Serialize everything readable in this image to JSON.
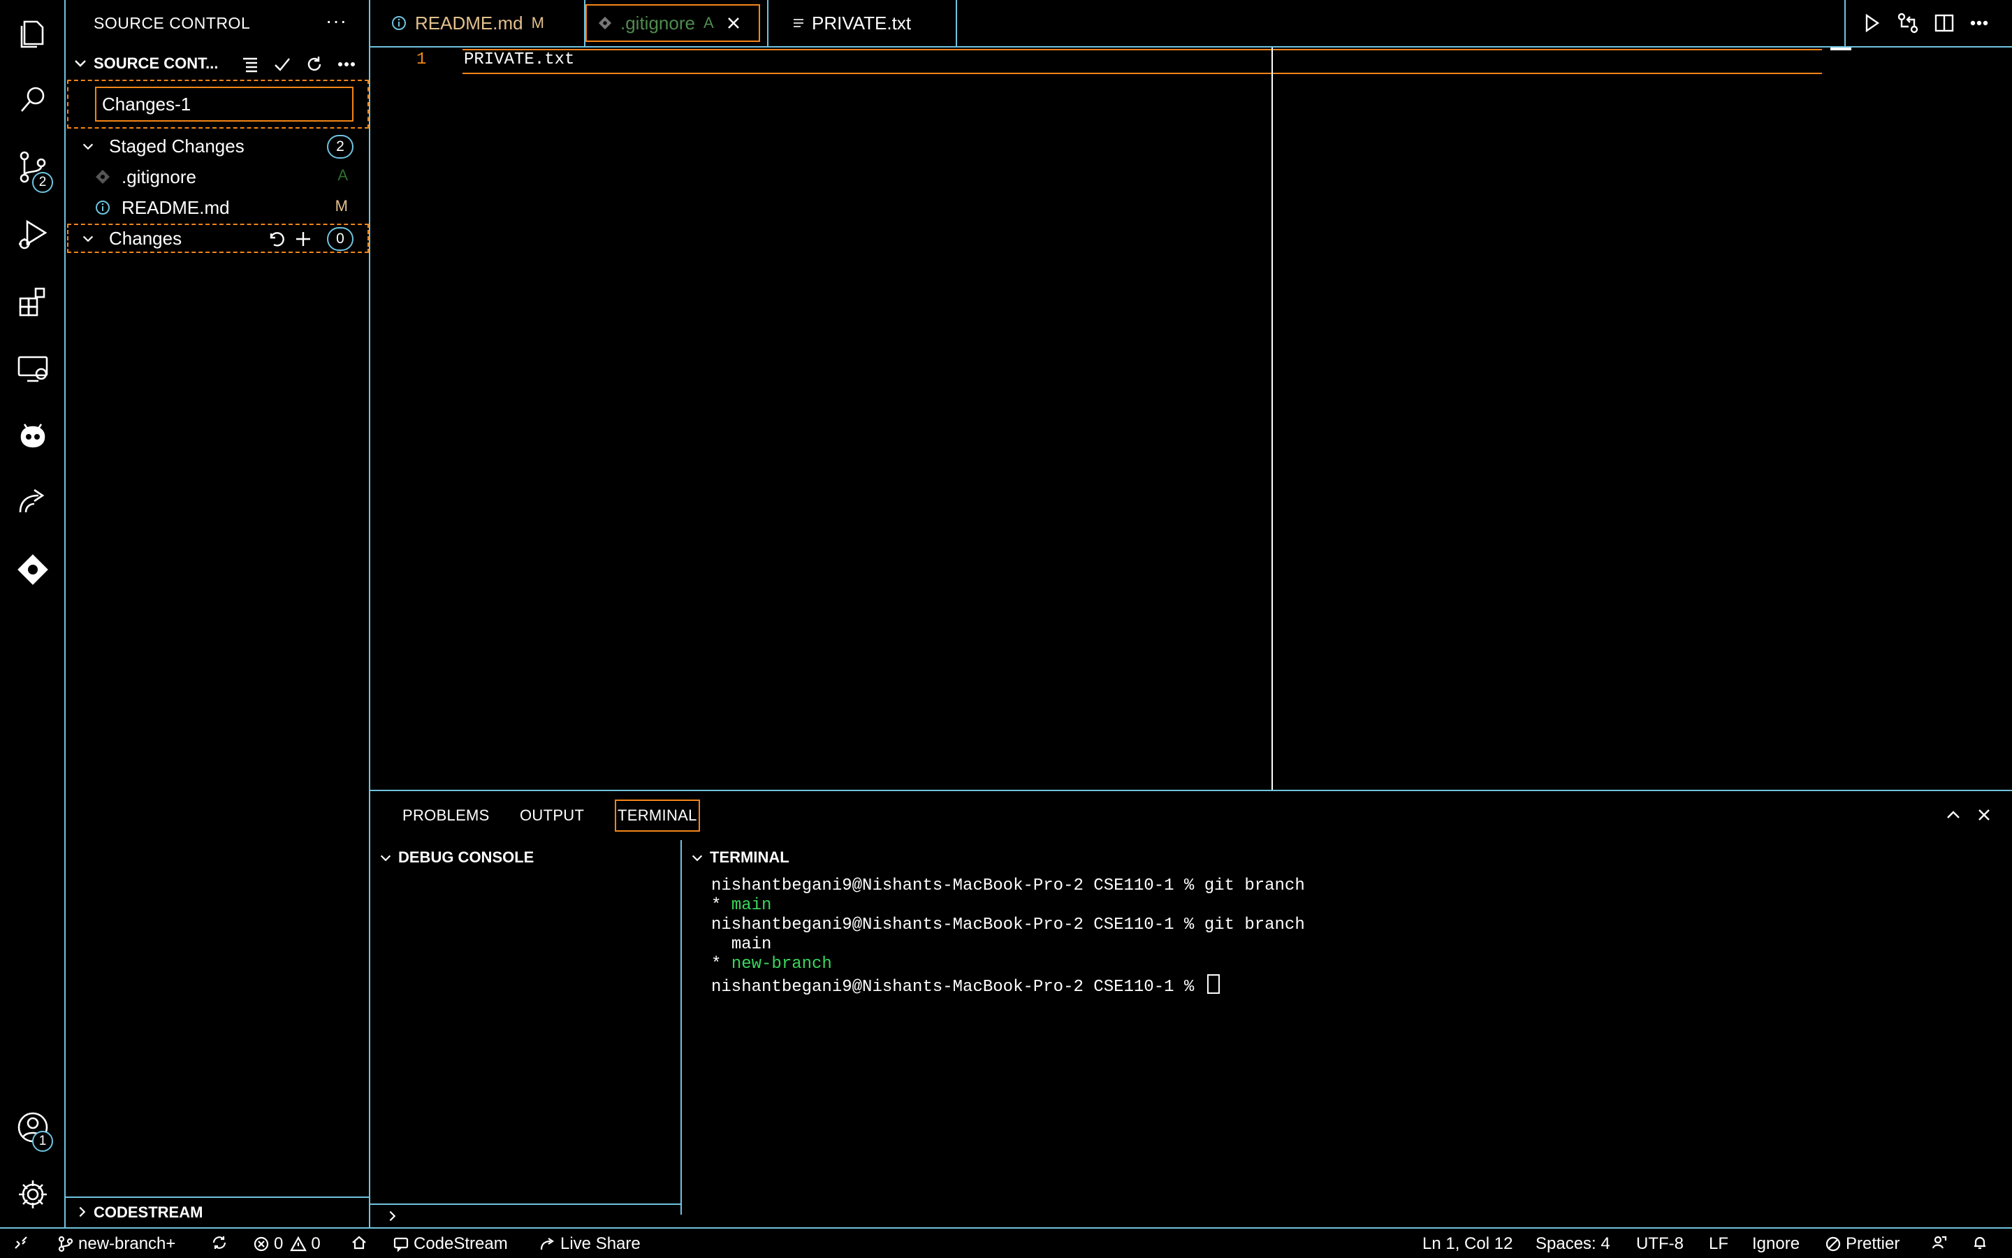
{
  "colors": {
    "border": "#6fc3df",
    "focus": "#f38518",
    "modified": "#e2c08d",
    "added": "#3ad65c",
    "gitignore_tab": "#4e8b4e",
    "terminal_green": "#3ad65c"
  },
  "activity_bar": {
    "items": [
      {
        "icon": "files-icon"
      },
      {
        "icon": "search-icon"
      },
      {
        "icon": "source-control-icon",
        "badge": "2"
      },
      {
        "icon": "run-debug-icon"
      },
      {
        "icon": "extensions-icon"
      },
      {
        "icon": "remote-explorer-icon"
      },
      {
        "icon": "platformio-icon"
      },
      {
        "icon": "live-share-icon"
      },
      {
        "icon": "codestream-icon"
      }
    ],
    "accounts_badge": "1"
  },
  "sidebar": {
    "title": "SOURCE CONTROL",
    "section_label": "SOURCE CONT...",
    "commit_message": "Changes-1",
    "staged": {
      "label": "Staged Changes",
      "count": "2",
      "files": [
        {
          "name": ".gitignore",
          "status": "A",
          "icon": "gitignore-file-icon"
        },
        {
          "name": "README.md",
          "status": "M",
          "icon": "info-file-icon"
        }
      ]
    },
    "changes": {
      "label": "Changes",
      "count": "0"
    },
    "codestream_label": "CODESTREAM"
  },
  "tabs": [
    {
      "label": "README.md",
      "status": "M",
      "icon": "info-file-icon"
    },
    {
      "label": ".gitignore",
      "status": "A",
      "icon": "gitignore-file-icon",
      "active": true
    },
    {
      "label": "PRIVATE.txt",
      "icon": "text-file-icon"
    }
  ],
  "editor": {
    "line_number": "1",
    "line_text": "PRIVATE.txt"
  },
  "panel": {
    "tabs": [
      "PROBLEMS",
      "OUTPUT",
      "TERMINAL"
    ],
    "active_tab": "TERMINAL",
    "debug_console_label": "DEBUG CONSOLE",
    "terminal_label": "TERMINAL",
    "terminal_lines": [
      {
        "prefix": "",
        "text": "nishantbegani9@Nishants-MacBook-Pro-2 CSE110-1 % git branch",
        "green": false
      },
      {
        "prefix": "* ",
        "text": "main",
        "green": true
      },
      {
        "prefix": "",
        "text": "nishantbegani9@Nishants-MacBook-Pro-2 CSE110-1 % git branch",
        "green": false
      },
      {
        "prefix": "  ",
        "text": "main",
        "green": false
      },
      {
        "prefix": "* ",
        "text": "new-branch",
        "green": true
      },
      {
        "prefix": "",
        "text": "nishantbegani9@Nishants-MacBook-Pro-2 CSE110-1 % ",
        "green": false
      }
    ]
  },
  "status_bar": {
    "branch": "new-branch+",
    "errors": "0",
    "warnings": "0",
    "codestream": "CodeStream",
    "live_share": "Live Share",
    "position": "Ln 1, Col 12",
    "spaces": "Spaces: 4",
    "encoding": "UTF-8",
    "eol": "LF",
    "ignore": "Ignore",
    "prettier": "Prettier"
  }
}
